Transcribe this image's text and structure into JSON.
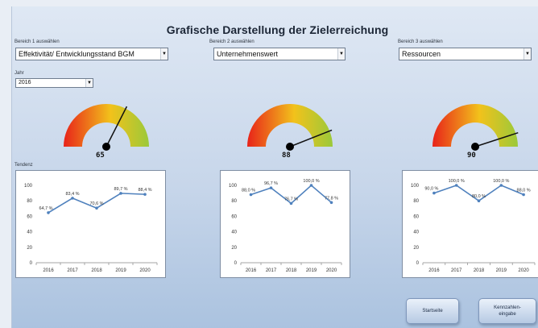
{
  "page": {
    "title": "Grafische Darstellung der Zielerreichung"
  },
  "areas": [
    {
      "label": "Bereich 1 auswählen",
      "selected": "Effektivität/ Entwicklungsstand BGM",
      "gauge_value": "65",
      "gauge_fraction": 0.65
    },
    {
      "label": "Bereich 2 auswählen",
      "selected": "Unternehmenswert",
      "gauge_value": "88",
      "gauge_fraction": 0.88
    },
    {
      "label": "Bereich 3 auswählen",
      "selected": "Ressourcen",
      "gauge_value": "90",
      "gauge_fraction": 0.9
    }
  ],
  "year": {
    "label": "Jahr",
    "selected": "2016"
  },
  "trend_label": "Tendenz",
  "buttons": {
    "start": "Startseite",
    "kennzahlen": "Kennzahlen-\neingabe"
  },
  "chart_data": [
    {
      "type": "line",
      "x": [
        "2016",
        "2017",
        "2018",
        "2019",
        "2020"
      ],
      "y_ticks": [
        "0",
        "20",
        "40",
        "60",
        "80",
        "100"
      ],
      "ylim": [
        0,
        100
      ],
      "series": [
        {
          "values": [
            64.7,
            83.4,
            70.6,
            89.7,
            88.4
          ],
          "labels": [
            "64,7 %",
            "83,4 %",
            "70,6 %",
            "89,7 %",
            "88,4 %"
          ]
        }
      ]
    },
    {
      "type": "line",
      "x": [
        "2016",
        "2017",
        "2018",
        "2019",
        "2020"
      ],
      "y_ticks": [
        "0",
        "20",
        "40",
        "60",
        "80",
        "100"
      ],
      "ylim": [
        0,
        100
      ],
      "series": [
        {
          "values": [
            88.0,
            96.7,
            76.7,
            100.0,
            77.8
          ],
          "labels": [
            "88,0 %",
            "96,7 %",
            "76,7 %",
            "100,0 %",
            "77,8 %"
          ]
        }
      ]
    },
    {
      "type": "line",
      "x": [
        "2016",
        "2017",
        "2018",
        "2019",
        "2020"
      ],
      "y_ticks": [
        "0",
        "20",
        "40",
        "60",
        "80",
        "100"
      ],
      "ylim": [
        0,
        100
      ],
      "series": [
        {
          "values": [
            90.0,
            100.0,
            80.0,
            100.0,
            88.0
          ],
          "labels": [
            "90,0 %",
            "100,0 %",
            "80,0 %",
            "100,0 %",
            "88,0 %"
          ]
        }
      ]
    }
  ],
  "colors": {
    "line": "#4f81bd",
    "gauge_red": "#e8231a",
    "gauge_yellow": "#f2c21b",
    "gauge_green": "#9bc93a",
    "button": "#b6c9e3"
  }
}
